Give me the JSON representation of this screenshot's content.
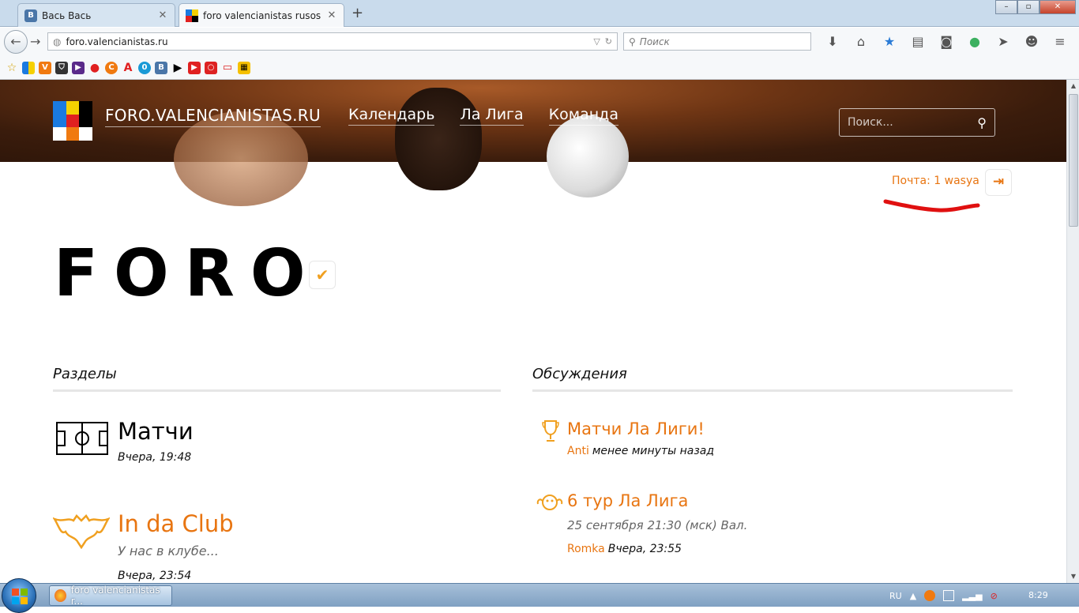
{
  "browser": {
    "tabs": [
      {
        "label": "Вась Вась",
        "active": false
      },
      {
        "label": "foro valencianistas rusos",
        "active": true
      }
    ],
    "new_tab": "+",
    "url": "foro.valencianistas.ru",
    "search_placeholder": "Поиск",
    "window_controls": {
      "minimize": "–",
      "maximize": "▫",
      "close": "✕"
    }
  },
  "site": {
    "name": "FORO.VALENCIANISTAS.RU",
    "nav": [
      "Календарь",
      "Ла Лига",
      "Команда"
    ],
    "search_placeholder": "Поиск..."
  },
  "user": {
    "mail_label": "Почта: 1 wasya"
  },
  "page": {
    "title": "FORO"
  },
  "sections": {
    "heading": "Разделы",
    "items": [
      {
        "title": "Матчи",
        "subtitle": "",
        "time": "Вчера, 19:48",
        "title_color": "#000000",
        "icon": "field-icon"
      },
      {
        "title": "In da Club",
        "subtitle": "У нас в клубе...",
        "time": "Вчера, 23:54",
        "title_color": "#e87511",
        "icon": "bat-icon"
      }
    ]
  },
  "discussions": {
    "heading": "Обсуждения",
    "items": [
      {
        "title": "Матчи Ла Лиги!",
        "subtitle": "",
        "author": "Anti",
        "time": "менее минуты назад",
        "icon": "trophy-icon"
      },
      {
        "title": "6 тур Ла Лига",
        "subtitle": "25 сентября 21:30 (мск) Вал.",
        "author": "Romka",
        "time": "Вчера, 23:55",
        "icon": "mascot-icon"
      }
    ]
  },
  "taskbar": {
    "item_label": "foro valencianistas r...",
    "lang": "RU",
    "clock": "8:29"
  },
  "colors": {
    "accent": "#e87511",
    "annotation_red": "#e01010"
  }
}
